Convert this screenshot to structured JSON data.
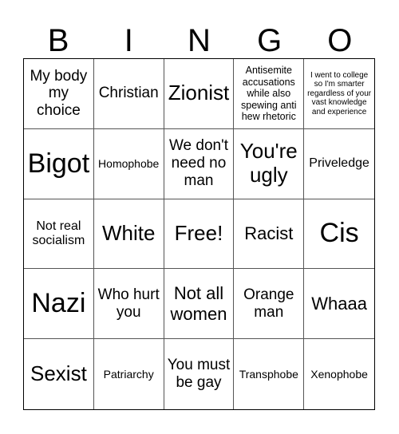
{
  "header": {
    "letters": [
      "B",
      "I",
      "N",
      "G",
      "O"
    ]
  },
  "cells": [
    "My body my choice",
    "Christian",
    "Zionist",
    "Antisemite accusations while also spewing anti hew rhetoric",
    "I went to college so I'm smarter regardless of your vast knowledge and experience",
    "Bigot",
    "Homophobe",
    "We don't need no man",
    "You're ugly",
    "Priveledge",
    "Not real socialism",
    "White",
    "Free!",
    "Racist",
    "Cis",
    "Nazi",
    "Who hurt you",
    "Not all women",
    "Orange man",
    "Whaaa",
    "Sexist",
    "Patriarchy",
    "You must be gay",
    "Transphobe",
    "Xenophobe"
  ]
}
